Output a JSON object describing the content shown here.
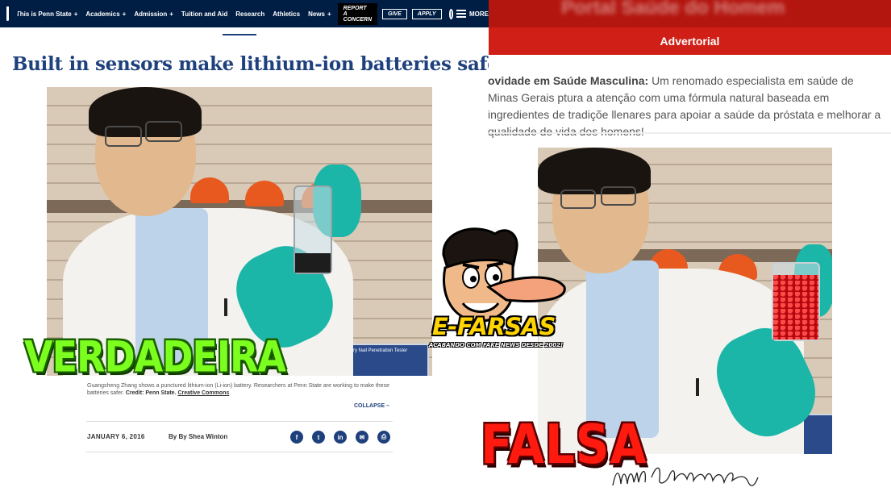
{
  "left_page": {
    "nav": {
      "items": [
        "This is Penn State",
        "Academics",
        "Admission",
        "Tuition and Aid",
        "Research",
        "Athletics",
        "News"
      ],
      "report_label": "REPORT A CONCERN",
      "give_label": "GIVE",
      "apply_label": "APPLY",
      "more_label": "MORE"
    },
    "title": "Built in sensors make lithium-ion batteries safer",
    "caption_text": "Guangsheng Zhang shows a punctured lithium-ion (Li-ion) battery. Researchers at Penn State are working to make these batteries safer.",
    "caption_credit_label": "Credit:",
    "caption_credit": "Penn State.",
    "caption_license": "Creative Commons",
    "collapse_label": "COLLAPSE –",
    "date": "JANUARY 6, 2016",
    "author": "By By Shea Winton",
    "share_icons": [
      "facebook-icon",
      "twitter-icon",
      "linkedin-icon",
      "email-icon",
      "print-icon"
    ],
    "device_label": "Battery Nail Penetration Tester"
  },
  "right_page": {
    "site_name": "Portal Saúde do Homem",
    "band_label": "Advertorial",
    "body_bold": "ovidade em Saúde Masculina:",
    "body_text": "Um renomado especialista em saúde de Minas Gerais ptura a atenção com uma fórmula natural baseada em ingredientes de tradiçõe llenares para apoiar a saúde da próstata e melhorar a qualidade de vida dos homens!"
  },
  "overlays": {
    "true_label": "VERDADEIRA",
    "false_label": "FALSA",
    "brand": "E-FARSAS",
    "tagline": "ACABANDO COM FAKE NEWS DESDE 2002!",
    "true_color": "#7cff1f",
    "false_color": "#ff1a0f",
    "brand_color": "#ffd400"
  },
  "colors": {
    "psu_navy": "#001e44",
    "psu_blue": "#1e407c",
    "fake_red": "#cf1f16"
  }
}
